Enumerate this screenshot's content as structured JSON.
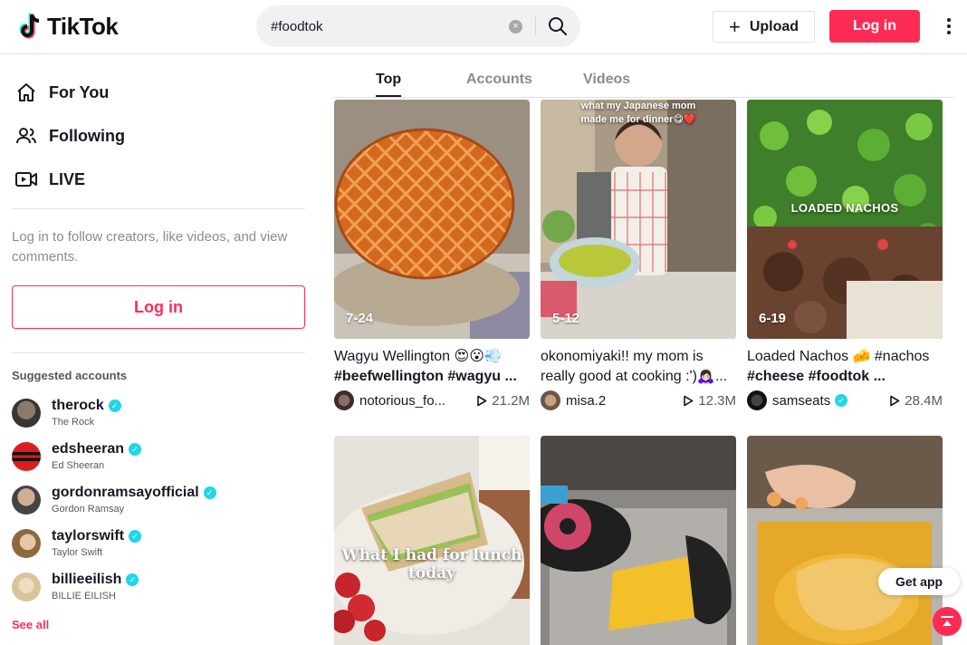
{
  "header": {
    "logo_text": "TikTok",
    "search_value": "#foodtok",
    "upload_label": "Upload",
    "login_label": "Log in"
  },
  "sidebar": {
    "nav": [
      {
        "label": "For You",
        "icon": "home-icon"
      },
      {
        "label": "Following",
        "icon": "people-icon"
      },
      {
        "label": "LIVE",
        "icon": "live-camera-icon"
      }
    ],
    "hint": "Log in to follow creators, like videos, and view comments.",
    "login_label": "Log in",
    "suggested_title": "Suggested accounts",
    "accounts": [
      {
        "username": "therock",
        "name": "The Rock",
        "verified": true
      },
      {
        "username": "edsheeran",
        "name": "Ed Sheeran",
        "verified": true
      },
      {
        "username": "gordonramsayofficial",
        "name": "Gordon Ramsay",
        "verified": true
      },
      {
        "username": "taylorswift",
        "name": "Taylor Swift",
        "verified": true
      },
      {
        "username": "billieeilish",
        "name": "BILLIE EILISH",
        "verified": true
      }
    ],
    "see_all": "See all"
  },
  "tabs": [
    "Top",
    "Accounts",
    "Videos"
  ],
  "active_tab": "Top",
  "videos": [
    {
      "date": "7-24",
      "desc_line1": "Wagyu Wellington 😍😮💨",
      "desc_line2": "#beefwellington #wagyu ...",
      "user": "notorious_fo...",
      "views": "21.2M",
      "overlay": "",
      "verified": false
    },
    {
      "date": "5-12",
      "desc_line1": "okonomiyaki!! my mom is",
      "desc_line2": "really good at cooking :')🙇🏻‍♀️...",
      "user": "misa.2",
      "views": "12.3M",
      "overlay": "what my Japanese mom made me for dinner😋❤️",
      "verified": false
    },
    {
      "date": "6-19",
      "desc_line1": "Loaded Nachos 🧀 #nachos",
      "desc_line2": "#cheese #foodtok ...",
      "user": "samseats",
      "views": "28.4M",
      "overlay": "LOADED NACHOS",
      "verified": true
    },
    {
      "date": "",
      "overlay": "What I had for lunch today"
    },
    {
      "date": "",
      "overlay": ""
    },
    {
      "date": "",
      "overlay": ""
    }
  ],
  "floating": {
    "get_app": "Get app"
  },
  "colors": {
    "brand": "#fe2c55",
    "verified": "#20d5ec"
  }
}
